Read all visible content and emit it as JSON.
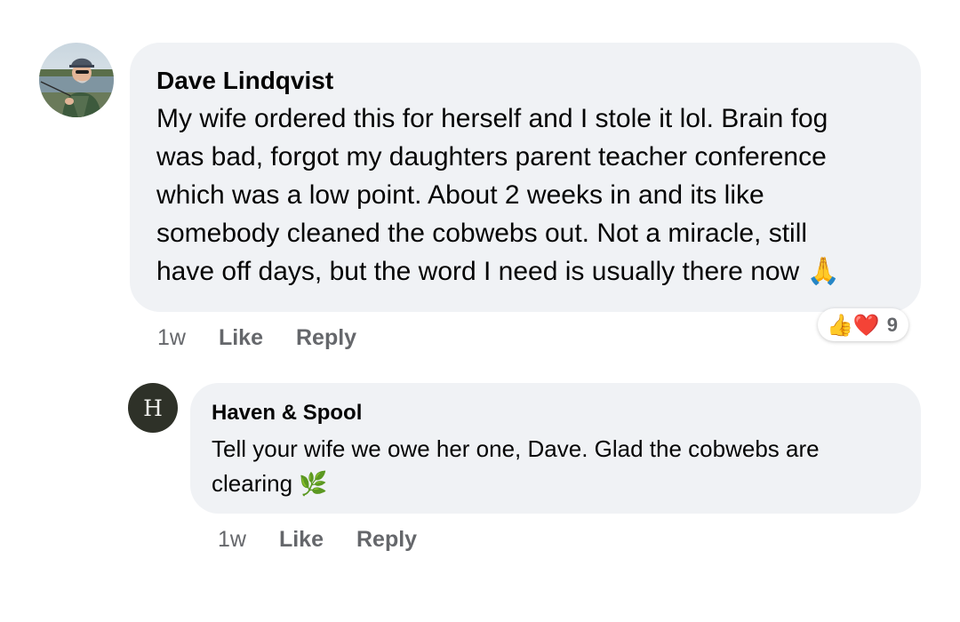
{
  "comment": {
    "author": "Dave Lindqvist",
    "text": "My wife ordered this for herself and I stole it lol. Brain fog\nwas bad, forgot my daughters parent teacher conference\nwhich was a low point. About 2 weeks in and its like\nsomebody cleaned the cobwebs out. Not a miracle, still\nhave off days, but the word I need is usually there now 🙏",
    "time": "1w",
    "like_label": "Like",
    "reply_label": "Reply",
    "reactions": {
      "emojis": [
        "👍",
        "❤️"
      ],
      "count": "9"
    },
    "avatar": "photo-avatar"
  },
  "reply": {
    "author": "Haven & Spool",
    "avatar_letter": "H",
    "text": "Tell your wife we owe her one, Dave. Glad the cobwebs are\nclearing 🌿",
    "time": "1w",
    "like_label": "Like",
    "reply_label": "Reply"
  },
  "colors": {
    "bubble_bg": "#f0f2f5",
    "meta_text": "#65676b",
    "reply_avatar_bg": "#2e3128"
  }
}
